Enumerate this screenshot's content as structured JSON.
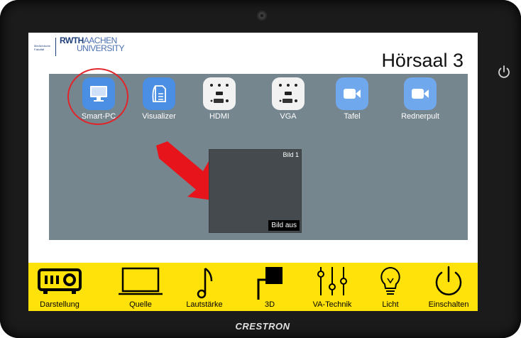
{
  "device": {
    "brand": "CRESTRON"
  },
  "header": {
    "logo": {
      "faculty_line": "Medizinische Fakultät",
      "university_line1_bold": "RWTH",
      "university_line1_light": "AACHEN",
      "university_line2": "UNIVERSITY"
    },
    "room_title": "Hörsaal 3"
  },
  "sources": [
    {
      "label": "Smart-PC",
      "icon": "monitor-icon",
      "selected": true
    },
    {
      "label": "Visualizer",
      "icon": "document-camera-icon",
      "selected": false
    },
    {
      "label": "HDMI",
      "icon": "hdmi-port-icon",
      "selected": false
    },
    {
      "label": "VGA",
      "icon": "vga-port-icon",
      "selected": false
    },
    {
      "label": "Tafel",
      "icon": "video-camera-icon",
      "selected": false
    },
    {
      "label": "Rednerpult",
      "icon": "video-camera-icon",
      "selected": false
    }
  ],
  "preview": {
    "name": "Bild 1",
    "off_button": "Bild aus"
  },
  "bottom_bar": [
    {
      "label": "Darstellung",
      "icon": "projector-icon"
    },
    {
      "label": "Quelle",
      "icon": "laptop-icon"
    },
    {
      "label": "Lautstärke",
      "icon": "music-note-icon"
    },
    {
      "label": "3D",
      "icon": "layers-icon"
    },
    {
      "label": "VA-Technik",
      "icon": "sliders-icon"
    },
    {
      "label": "Licht",
      "icon": "light-bulb-icon"
    },
    {
      "label": "Einschalten",
      "icon": "power-icon"
    }
  ],
  "colors": {
    "panel": "#76868f",
    "bottom_bar": "#ffe20a",
    "selection_ring": "#e0242a",
    "arrow": "#e8141c",
    "tile_blue": "#4a8fe4"
  }
}
